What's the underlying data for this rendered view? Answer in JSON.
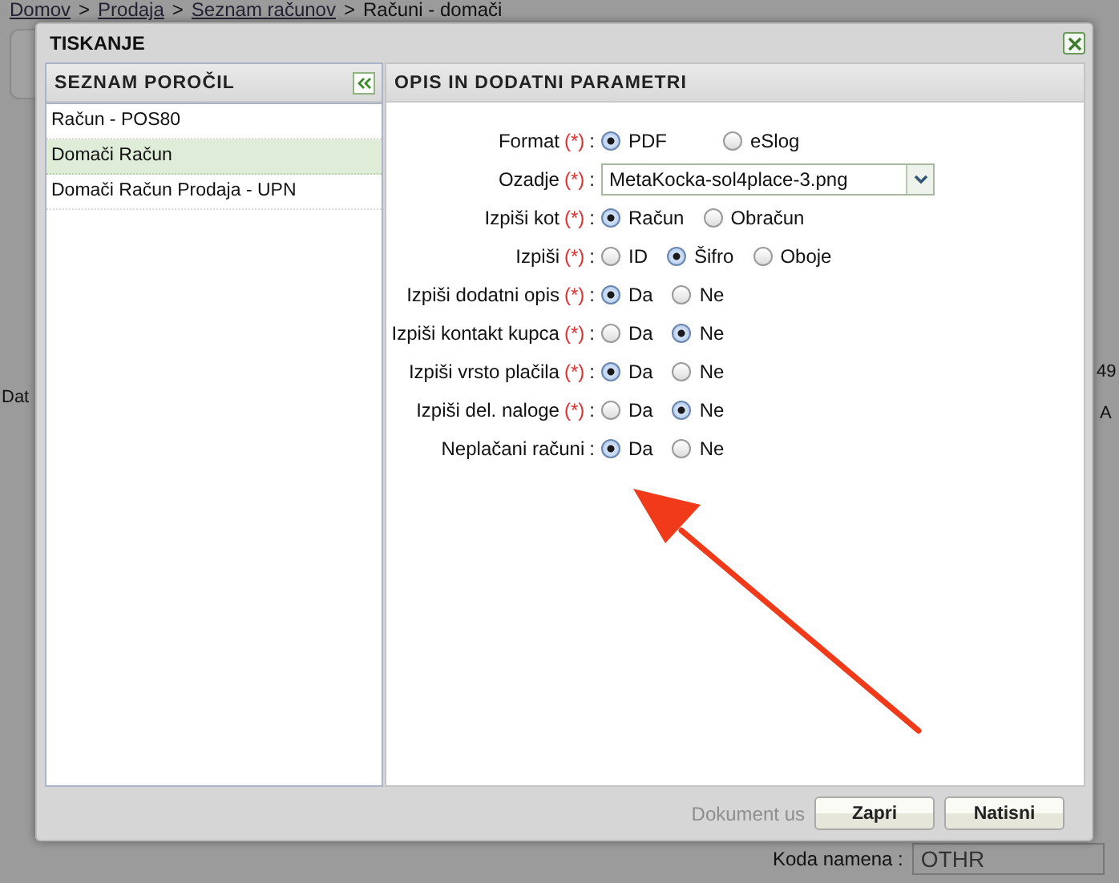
{
  "breadcrumb": {
    "links": [
      "Domov",
      "Prodaja",
      "Seznam računov"
    ],
    "current": "Računi - domači",
    "separator": ">"
  },
  "background_texts": [
    "Dat",
    "49",
    "A"
  ],
  "background_field": {
    "label": "Koda namena :",
    "value": "OTHR"
  },
  "dialog": {
    "title": "TISKANJE",
    "left_panel": {
      "title": "SEZNAM POROČIL",
      "items": [
        {
          "label": "Račun - POS80",
          "selected": false
        },
        {
          "label": "Domači Račun",
          "selected": true
        },
        {
          "label": "Domači Račun Prodaja - UPN",
          "selected": false
        }
      ]
    },
    "right_panel": {
      "title": "OPIS IN DODATNI PARAMETRI",
      "fields": [
        {
          "label": "Format",
          "required": true,
          "kind": "radio",
          "options": [
            {
              "label": "PDF",
              "selected": true
            },
            {
              "label": "eSlog",
              "selected": false
            }
          ]
        },
        {
          "label": "Ozadje",
          "required": true,
          "kind": "select",
          "value": "MetaKocka-sol4place-3.png"
        },
        {
          "label": "Izpiši kot",
          "required": true,
          "kind": "radio",
          "options": [
            {
              "label": "Račun",
              "selected": true
            },
            {
              "label": "Obračun",
              "selected": false
            }
          ]
        },
        {
          "label": "Izpiši",
          "required": true,
          "kind": "radio",
          "options": [
            {
              "label": "ID",
              "selected": false
            },
            {
              "label": "Šifro",
              "selected": true
            },
            {
              "label": "Oboje",
              "selected": false
            }
          ]
        },
        {
          "label": "Izpiši dodatni opis",
          "required": true,
          "kind": "radio",
          "options": [
            {
              "label": "Da",
              "selected": true
            },
            {
              "label": "Ne",
              "selected": false
            }
          ]
        },
        {
          "label": "Izpiši kontakt kupca",
          "required": true,
          "kind": "radio",
          "options": [
            {
              "label": "Da",
              "selected": false
            },
            {
              "label": "Ne",
              "selected": true
            }
          ]
        },
        {
          "label": "Izpiši vrsto plačila",
          "required": true,
          "kind": "radio",
          "options": [
            {
              "label": "Da",
              "selected": true
            },
            {
              "label": "Ne",
              "selected": false
            }
          ]
        },
        {
          "label": "Izpiši del. naloge",
          "required": true,
          "kind": "radio",
          "options": [
            {
              "label": "Da",
              "selected": false
            },
            {
              "label": "Ne",
              "selected": true
            }
          ]
        },
        {
          "label": "Neplačani računi",
          "required": false,
          "kind": "radio",
          "options": [
            {
              "label": "Da",
              "selected": true
            },
            {
              "label": "Ne",
              "selected": false
            }
          ]
        }
      ],
      "required_mark": "(*)",
      "separator": ":"
    },
    "footer_text": "Dokument us",
    "buttons": [
      "Zapri",
      "Natisni"
    ]
  }
}
